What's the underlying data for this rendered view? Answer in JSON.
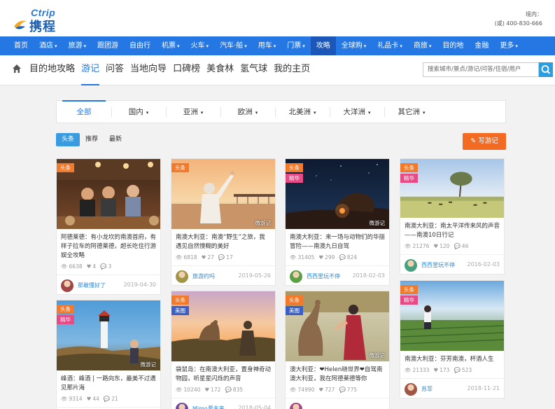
{
  "header": {
    "logo_en": "Ctrip",
    "logo_cn": "携程",
    "right_line1": "境内：",
    "right_line2": "(或) 400-830-666"
  },
  "nav": {
    "items": [
      {
        "label": "首页"
      },
      {
        "label": "酒店",
        "caret": "▾"
      },
      {
        "label": "旅游",
        "caret": "▾"
      },
      {
        "label": "跟团游"
      },
      {
        "label": "自由行"
      },
      {
        "label": "机票",
        "caret": "▾"
      },
      {
        "label": "火车",
        "caret": "▾"
      },
      {
        "label": "汽车·船",
        "caret": "▾"
      },
      {
        "label": "用车",
        "caret": "▾"
      },
      {
        "label": "门票",
        "caret": "▾"
      },
      {
        "label": "攻略"
      },
      {
        "label": "全球购",
        "caret": "▾"
      },
      {
        "label": "礼品卡",
        "caret": "▾"
      },
      {
        "label": "商旅",
        "caret": "▾"
      },
      {
        "label": "目的地"
      },
      {
        "label": "金融"
      },
      {
        "label": "更多",
        "caret": "▾"
      }
    ],
    "active_index": 10
  },
  "subnav": {
    "items": [
      "目的地攻略",
      "游记",
      "问答",
      "当地向导",
      "口碑榜",
      "美食林",
      "氢气球",
      "我的主页"
    ],
    "active_index": 1,
    "search_placeholder": "搜索城市/景点/游记/问答/住宿/用户"
  },
  "filter": {
    "items": [
      {
        "label": "全部"
      },
      {
        "label": "国内",
        "caret": "▾"
      },
      {
        "label": "亚洲",
        "caret": "▾"
      },
      {
        "label": "欧洲",
        "caret": "▾"
      },
      {
        "label": "北美洲",
        "caret": "▾"
      },
      {
        "label": "大洋洲",
        "caret": "▾"
      },
      {
        "label": "其它洲",
        "caret": "▾"
      }
    ],
    "active_index": 0
  },
  "tabs": {
    "items": [
      "头条",
      "推荐",
      "最新"
    ],
    "active_index": 0,
    "write_button": "写游记"
  },
  "cards": [
    {
      "tags": [
        "头条"
      ],
      "watermark": "",
      "title": "阿德莱德：有小龙坎的南澳首府，有样子拉车的阿德莱德，超长吃住行游娱全攻略",
      "views": "6638",
      "likes": "4",
      "comments": "3",
      "user": "那敢懂好了",
      "date": "2019-04-30"
    },
    {
      "tags": [
        "头条"
      ],
      "watermark": "微游记",
      "title": "南澳大利亚：南澳“野生”之旅，我遇见自然懊糊的美好",
      "views": "6818",
      "likes": "27",
      "comments": "17",
      "user": "旅游约吗",
      "date": "2019-05-26"
    },
    {
      "tags": [
        "头条",
        "精华"
      ],
      "watermark": "微游记",
      "title": "南澳大利亚：来一场与动物们的华丽冒险——南澳九日自驾",
      "views": "31405",
      "likes": "299",
      "comments": "824",
      "user": "西西里玩不停",
      "date": "2018-02-03"
    },
    {
      "tags": [
        "头条",
        "精华"
      ],
      "watermark": "",
      "title": "南澳大利亚：南太平洋传来风的声音——南澳10日行记",
      "views": "21276",
      "likes": "120",
      "comments": "46",
      "user": "西西里玩不停",
      "date": "2016-02-03"
    },
    {
      "tags": [
        "头条",
        "精华"
      ],
      "watermark": "微游记",
      "title": "峰酒：峰酒 | 一路向东，最美不过遇见那片海",
      "views": "9314",
      "likes": "44",
      "comments": "21",
      "user": "",
      "date": ""
    },
    {
      "tags": [
        "头条",
        "美图"
      ],
      "watermark": "",
      "title": "袋鼠岛：在南澳大利亚，置身神奇动物园，听星星闪烁的声音",
      "views": "10240",
      "likes": "172",
      "comments": "835",
      "user": "Mimo夏未来",
      "date": "2018-05-04"
    },
    {
      "tags": [
        "头条",
        "美图"
      ],
      "watermark": "微游记",
      "title": "澳大利亚：❤Helen晓世界❤自驾南澳大利亚，我在阿德莱德等你",
      "views": "74990",
      "likes": "727",
      "comments": "775",
      "user": "",
      "date": ""
    },
    {
      "tags": [
        "头条",
        "精华"
      ],
      "watermark": "",
      "title": "南澳大利亚：芬芳南澳，杯酒人生",
      "views": "21333",
      "likes": "173",
      "comments": "523",
      "user": "苏菲",
      "date": "2018-11-21"
    }
  ]
}
